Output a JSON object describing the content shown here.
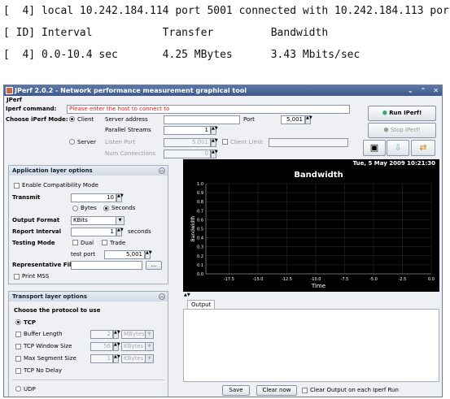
{
  "terminal": {
    "line1": "[  4] local 10.242.184.114 port 5001 connected with 10.242.184.113 port",
    "line2": "[ ID] Interval           Transfer         Bandwidth",
    "line3": "[  4] 0.0-10.4 sec       4.25 MBytes      3.43 Mbits/sec"
  },
  "window": {
    "title": "JPerf 2.0.2 - Network performance measurement graphical tool",
    "menu": "JPerf"
  },
  "command": {
    "label": "Iperf command:",
    "message": "Please enter the host to connect to"
  },
  "mode": {
    "label": "Choose iPerf Mode:",
    "client_label": "Client",
    "server_label": "Server",
    "server_address_label": "Server address",
    "server_address_value": "",
    "port_label": "Port",
    "port_value": "5,001",
    "parallel_label": "Parallel Streams",
    "parallel_value": "1",
    "listen_port_label": "Listen Port",
    "listen_port_value": "5,001",
    "client_limit_label": "Client Limit",
    "num_conn_label": "Num Connections",
    "num_conn_value": "0"
  },
  "actions": {
    "run": "Run IPerf!",
    "stop": "Stop IPerf!"
  },
  "app_layer": {
    "title": "Application layer options",
    "compat": "Enable Compatibility Mode",
    "transmit_label": "Transmit",
    "transmit_value": "10",
    "bytes": "Bytes",
    "seconds": "Seconds",
    "output_format_label": "Output Format",
    "output_format_value": "KBits",
    "report_label": "Report Interval",
    "report_value": "1",
    "report_unit": "seconds",
    "testing_label": "Testing Mode",
    "dual": "Dual",
    "trade": "Trade",
    "test_port_label": "test port",
    "test_port_value": "5,001",
    "rep_file_label": "Representative File",
    "rep_file_btn": "...",
    "print_mss": "Print MSS"
  },
  "transport": {
    "title": "Transport layer options",
    "choose": "Choose the protocol to use",
    "tcp": "TCP",
    "buffer_label": "Buffer Length",
    "buffer_value": "2",
    "buffer_unit": "MBytes",
    "window_label": "TCP Window Size",
    "window_value": "56",
    "window_unit": "KBytes",
    "mss_label": "Max Segment Size",
    "mss_value": "1",
    "mss_unit": "KBytes",
    "nodelay": "TCP No Delay",
    "udp": "UDP"
  },
  "chart_data": {
    "type": "line",
    "title": "Bandwidth",
    "timestamp": "Tue, 5 May 2009 10:21:30",
    "xlabel": "Time",
    "ylabel": "Bandwidth",
    "xlim": [
      -19.5,
      0
    ],
    "ylim": [
      0,
      1.0
    ],
    "x_ticks": [
      "-17.5",
      "-15.0",
      "-12.5",
      "-10.0",
      "-7.5",
      "-5.0",
      "-2.5",
      "0.0"
    ],
    "y_ticks": [
      "1.0",
      "0.9",
      "0.8",
      "0.7",
      "0.6",
      "0.5",
      "0.4",
      "0.3",
      "0.2",
      "0.1",
      "0.0"
    ],
    "series": [],
    "grid": true
  },
  "output": {
    "tab": "Output",
    "save": "Save",
    "clear": "Clear now",
    "clear_each": "Clear Output on each Iperf Run"
  }
}
